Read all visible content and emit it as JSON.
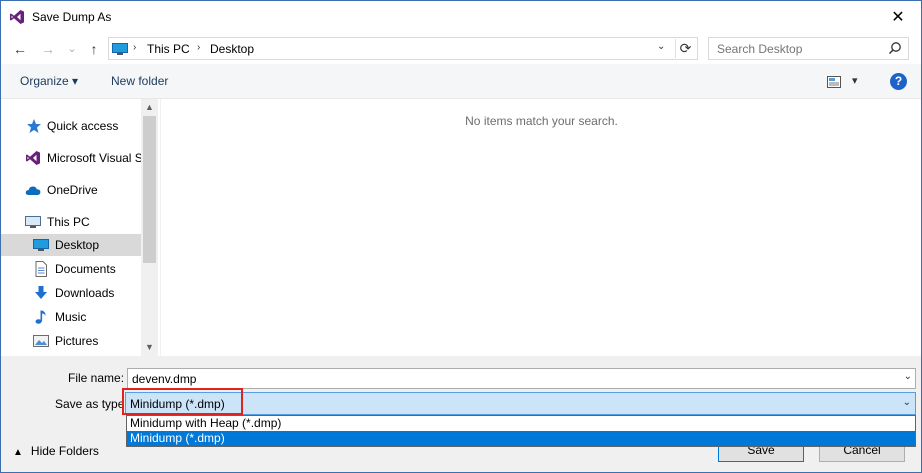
{
  "window": {
    "title": "Save Dump As",
    "close_glyph": "✕"
  },
  "nav": {
    "back_glyph": "←",
    "forward_glyph": "→",
    "recent_glyph": "⌄",
    "up_glyph": "↑",
    "breadcrumb": [
      "This PC",
      "Desktop"
    ],
    "breadcrumb_sep": "›",
    "address_dropdown_glyph": "⌄",
    "refresh_glyph": "⟳",
    "search_placeholder": "Search Desktop"
  },
  "toolbar": {
    "organize_label": "Organize ▾",
    "new_folder_label": "New folder",
    "view_dropdown_glyph": "▾",
    "help_glyph": "?"
  },
  "sidebar": {
    "items": [
      {
        "label": "Quick access",
        "icon": "star-icon"
      },
      {
        "label": "Microsoft Visual S",
        "icon": "visual-studio-icon"
      },
      {
        "label": "OneDrive",
        "icon": "cloud-icon"
      },
      {
        "label": "This PC",
        "icon": "computer-icon"
      },
      {
        "label": "Desktop",
        "icon": "desktop-icon",
        "selected": true
      },
      {
        "label": "Documents",
        "icon": "document-icon"
      },
      {
        "label": "Downloads",
        "icon": "download-arrow-icon"
      },
      {
        "label": "Music",
        "icon": "music-note-icon"
      },
      {
        "label": "Pictures",
        "icon": "picture-icon"
      }
    ],
    "scroll_up_glyph": "▲",
    "scroll_down_glyph": "▼"
  },
  "content": {
    "empty_message": "No items match your search."
  },
  "bottom": {
    "file_name_label": "File name:",
    "file_name_value": "devenv.dmp",
    "save_type_label": "Save as type:",
    "save_type_value": "Minidump (*.dmp)",
    "dropdown_glyph": "⌄",
    "options": [
      {
        "label": "Minidump with Heap (*.dmp)",
        "selected": false
      },
      {
        "label": "Minidump (*.dmp)",
        "selected": true
      }
    ],
    "hide_folders_glyph": "▲",
    "hide_folders_label": "Hide Folders",
    "save_label": "Save",
    "cancel_label": "Cancel"
  },
  "colors": {
    "accent": "#0078d7",
    "highlight_border": "#e0231e",
    "selection_bg": "#cce4f7"
  }
}
